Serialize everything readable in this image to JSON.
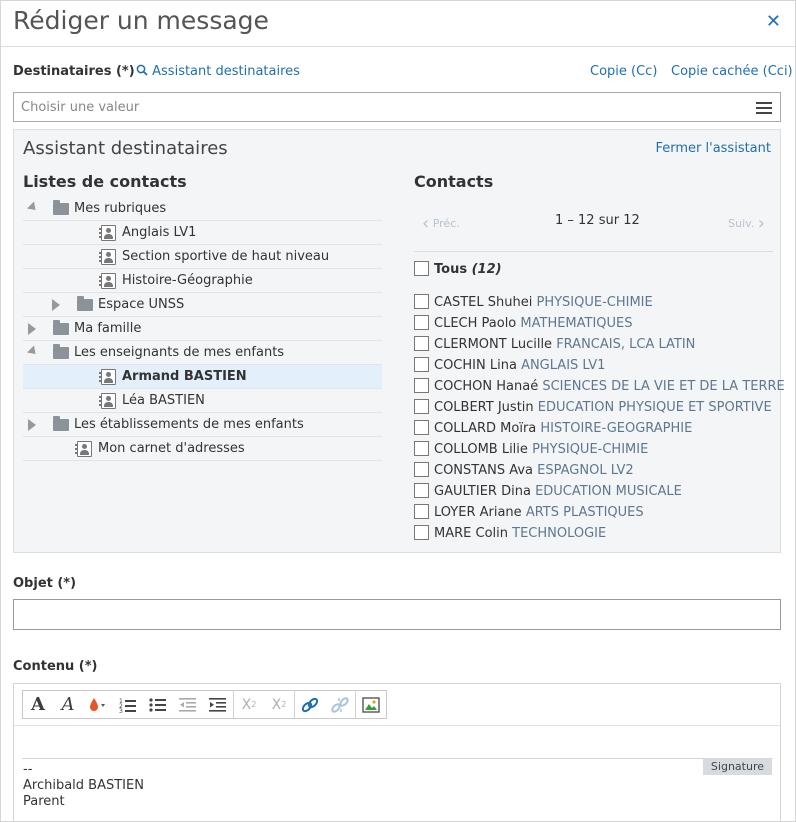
{
  "dialog": {
    "title": "Rédiger un message",
    "close_label": "✕"
  },
  "recipients": {
    "label": "Destinataires (*)",
    "assistant_link": "Assistant destinataires",
    "cc_link": "Copie (Cc)",
    "bcc_link": "Copie cachée (Cci)",
    "placeholder": "Choisir une valeur"
  },
  "assistant": {
    "title": "Assistant destinataires",
    "close_link": "Fermer l'assistant",
    "lists_title": "Listes de contacts",
    "contacts_title": "Contacts",
    "tree": [
      {
        "label": "Mes rubriques",
        "type": "folder",
        "state": "open",
        "level": 0
      },
      {
        "label": "Anglais LV1",
        "type": "contact",
        "level": 2
      },
      {
        "label": "Section sportive de haut niveau",
        "type": "contact",
        "level": 2
      },
      {
        "label": "Histoire-Géographie",
        "type": "contact",
        "level": 2
      },
      {
        "label": "Espace UNSS",
        "type": "folder",
        "state": "closed",
        "level": 1
      },
      {
        "label": "Ma famille",
        "type": "folder",
        "state": "closed",
        "level": 0
      },
      {
        "label": "Les enseignants de mes enfants",
        "type": "folder",
        "state": "open",
        "level": 0
      },
      {
        "label": "Armand BASTIEN",
        "type": "contact",
        "level": 2,
        "selected": true
      },
      {
        "label": "Léa BASTIEN",
        "type": "contact",
        "level": 2
      },
      {
        "label": "Les établissements de mes enfants",
        "type": "folder",
        "state": "closed",
        "level": 0
      },
      {
        "label": "Mon carnet d'adresses",
        "type": "contact",
        "level": 1
      }
    ],
    "pager": {
      "prev": "Préc.",
      "count": "1 – 12 sur 12",
      "next": "Suiv."
    },
    "all": {
      "label": "Tous",
      "count": "(12)"
    },
    "contacts": [
      {
        "name": "CASTEL Shuhei",
        "subject": "PHYSIQUE-CHIMIE"
      },
      {
        "name": "CLECH Paolo",
        "subject": "MATHEMATIQUES"
      },
      {
        "name": "CLERMONT Lucille",
        "subject": "FRANCAIS, LCA LATIN"
      },
      {
        "name": "COCHIN Lina",
        "subject": "ANGLAIS LV1"
      },
      {
        "name": "COCHON Hanaé",
        "subject": "SCIENCES DE LA VIE ET DE LA TERRE"
      },
      {
        "name": "COLBERT Justin",
        "subject": "EDUCATION PHYSIQUE ET SPORTIVE"
      },
      {
        "name": "COLLARD Moïra",
        "subject": "HISTOIRE-GEOGRAPHIE"
      },
      {
        "name": "COLLOMB Lilie",
        "subject": "PHYSIQUE-CHIMIE"
      },
      {
        "name": "CONSTANS Ava",
        "subject": "ESPAGNOL LV2"
      },
      {
        "name": "GAULTIER Dina",
        "subject": "EDUCATION MUSICALE"
      },
      {
        "name": "LOYER Ariane",
        "subject": "ARTS PLASTIQUES"
      },
      {
        "name": "MARE Colin",
        "subject": "TECHNOLOGIE"
      }
    ]
  },
  "subject": {
    "label": "Objet (*)",
    "value": ""
  },
  "content": {
    "label": "Contenu (*)",
    "signature_button": "Signature",
    "signature_text": "--\nArchibald BASTIEN\nParent"
  },
  "colors": {
    "accent": "#1f6fb2",
    "selected_row": "#e3f0fb",
    "panel_bg": "#f4f5f6",
    "subject_text": "#5e7791"
  }
}
